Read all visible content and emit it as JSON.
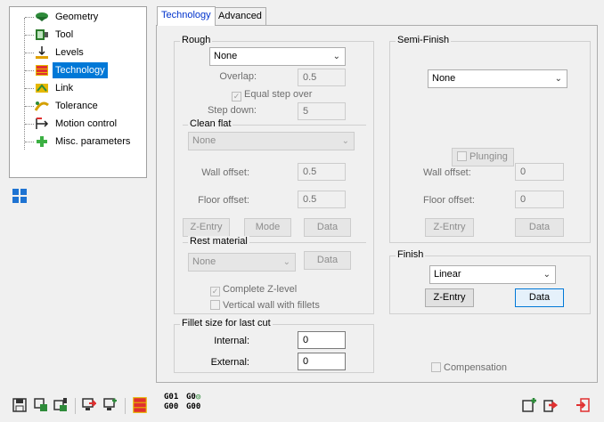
{
  "tree": {
    "items": [
      {
        "label": "Geometry",
        "icon": "geometry-icon"
      },
      {
        "label": "Tool",
        "icon": "tool-icon"
      },
      {
        "label": "Levels",
        "icon": "levels-icon"
      },
      {
        "label": "Technology",
        "icon": "technology-icon",
        "selected": true
      },
      {
        "label": "Link",
        "icon": "link-icon"
      },
      {
        "label": "Tolerance",
        "icon": "tolerance-icon"
      },
      {
        "label": "Motion control",
        "icon": "motion-control-icon"
      },
      {
        "label": "Misc. parameters",
        "icon": "misc-parameters-icon"
      }
    ]
  },
  "tabs": {
    "technology": "Technology",
    "advanced": "Advanced"
  },
  "rough": {
    "title": "Rough",
    "strategy": "None",
    "overlap_label": "Overlap:",
    "overlap_value": "0.5",
    "equal_step_over": "Equal step over",
    "step_down_label": "Step down:",
    "step_down_value": "5",
    "clean_flat_title": "Clean flat",
    "clean_flat_value": "None",
    "wall_offset_label": "Wall offset:",
    "wall_offset_value": "0.5",
    "floor_offset_label": "Floor offset:",
    "floor_offset_value": "0.5",
    "z_entry": "Z-Entry",
    "mode": "Mode",
    "data": "Data",
    "rest_title": "Rest material",
    "rest_value": "None",
    "rest_data": "Data",
    "complete_z_level": "Complete Z-level",
    "vertical_wall": "Vertical wall with fillets"
  },
  "fillet": {
    "title": "Fillet size for last cut",
    "internal_label": "Internal:",
    "internal_value": "0",
    "external_label": "External:",
    "external_value": "0"
  },
  "semi_finish": {
    "title": "Semi-Finish",
    "strategy": "None",
    "plunging": "Plunging",
    "wall_offset_label": "Wall offset:",
    "wall_offset_value": "0",
    "floor_offset_label": "Floor offset:",
    "floor_offset_value": "0",
    "z_entry": "Z-Entry",
    "data": "Data"
  },
  "finish": {
    "title": "Finish",
    "strategy": "Linear",
    "z_entry": "Z-Entry",
    "data": "Data"
  },
  "compensation": "Compensation",
  "toolbar": {
    "g01": "G01",
    "g00a": "G00",
    "g0": "G0",
    "g00b": "G00"
  },
  "colors": {
    "selection": "#0078d7",
    "tab_active_text": "#0033cc"
  }
}
